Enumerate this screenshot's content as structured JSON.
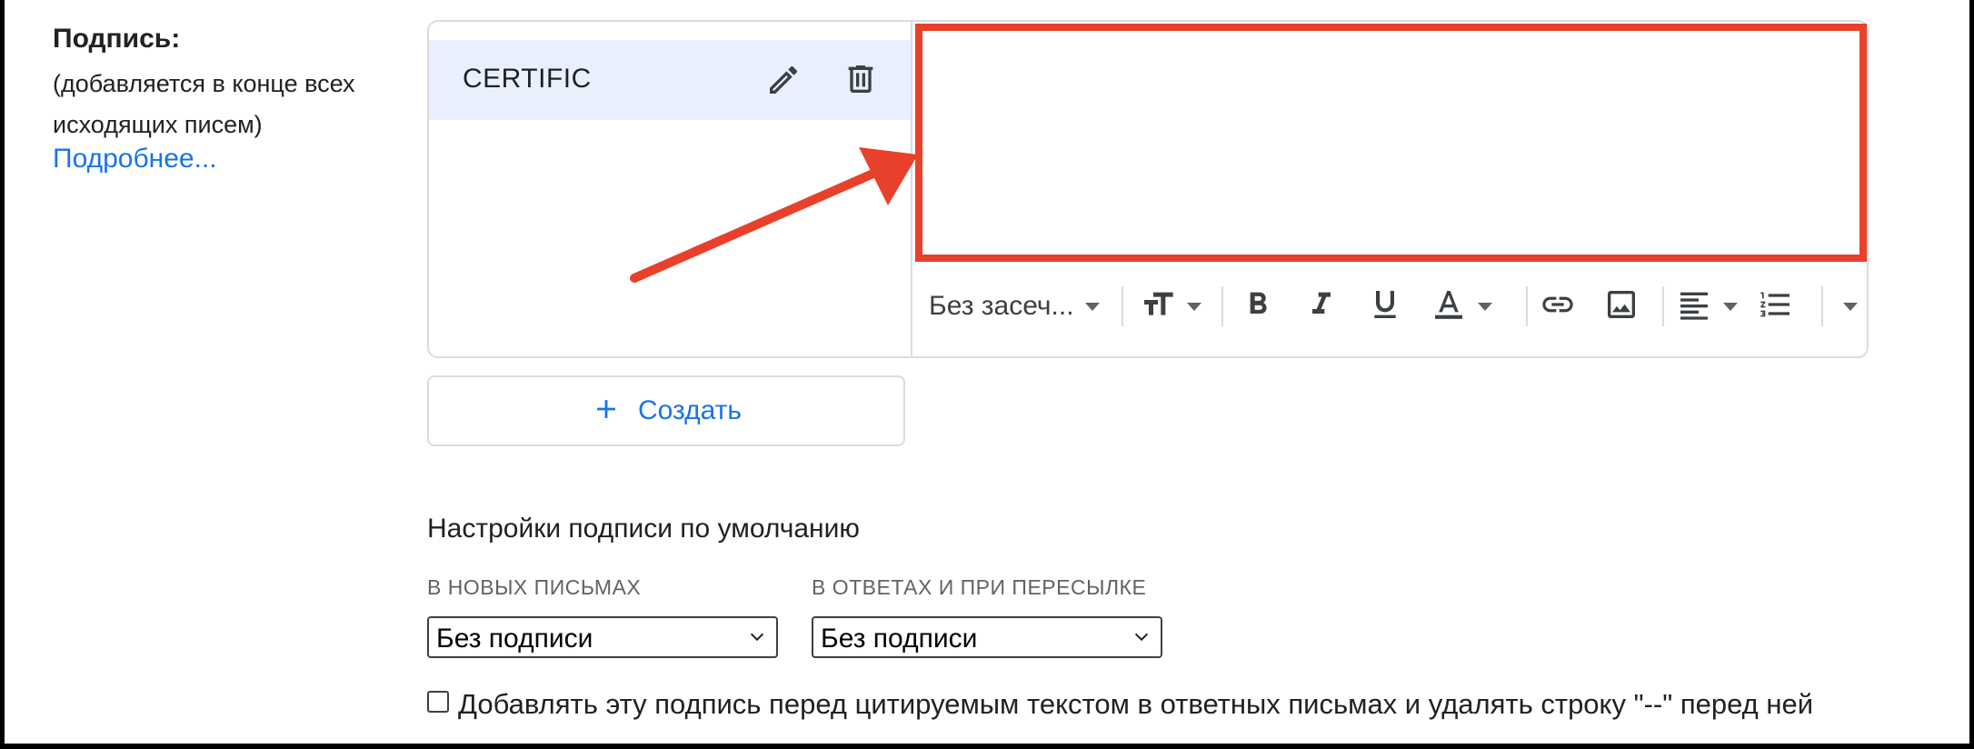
{
  "signature_section": {
    "title": "Подпись:",
    "description": "(добавляется в конце всех исходящих писем)",
    "learn_more": "Подробнее..."
  },
  "signature_list": {
    "items": [
      {
        "name": "CERTIFIC",
        "selected": true
      }
    ]
  },
  "editor": {
    "highlight_color": "#e8402b",
    "toolbar": {
      "font_family": "Без засеч..."
    }
  },
  "create_button": {
    "label": "Создать"
  },
  "defaults": {
    "title": "Настройки подписи по умолчанию",
    "new_messages": {
      "label": "В НОВЫХ ПИСЬМАХ",
      "value": "Без подписи"
    },
    "replies": {
      "label": "В ОТВЕТАХ И ПРИ ПЕРЕСЫЛКЕ",
      "value": "Без подписи"
    }
  },
  "insert_before_quote": {
    "checked": false,
    "label": "Добавлять эту подпись перед цитируемым текстом в ответных письмах и удалять строку \"--\" перед ней"
  },
  "colors": {
    "link": "#1a73e8",
    "selected_item_bg": "#e8f0fe",
    "annotation_red": "#e8402b"
  }
}
